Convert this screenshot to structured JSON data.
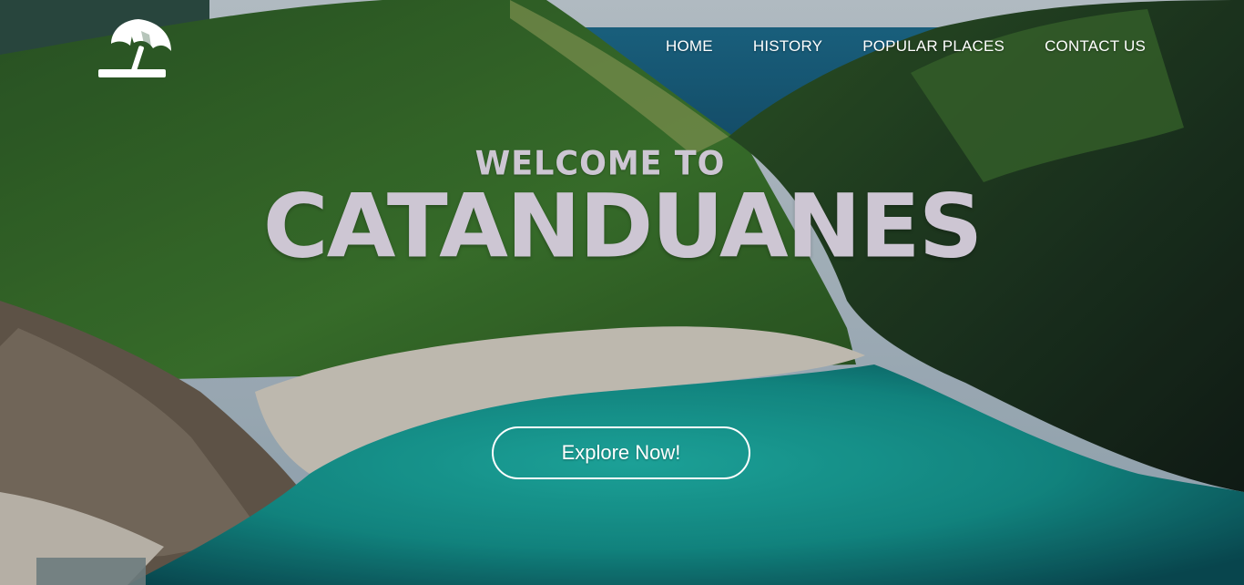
{
  "site": {
    "logo_icon": "beach-umbrella-icon"
  },
  "nav": {
    "items": [
      {
        "label": "HOME"
      },
      {
        "label": "HISTORY"
      },
      {
        "label": "POPULAR PLACES"
      },
      {
        "label": "CONTACT US"
      }
    ]
  },
  "hero": {
    "subtitle": "WELCOME TO",
    "title": "CATANDUANES",
    "cta_label": "Explore Now!",
    "background": "aerial-photo-green-hills-white-beach-turquoise-cove"
  },
  "colors": {
    "title_text": "#cdc6d3",
    "nav_text": "#ffffff",
    "button_border": "#ffffff",
    "water": "#1aa6a0",
    "foliage": "#2f6a2e",
    "sand": "#d9d3c8"
  }
}
